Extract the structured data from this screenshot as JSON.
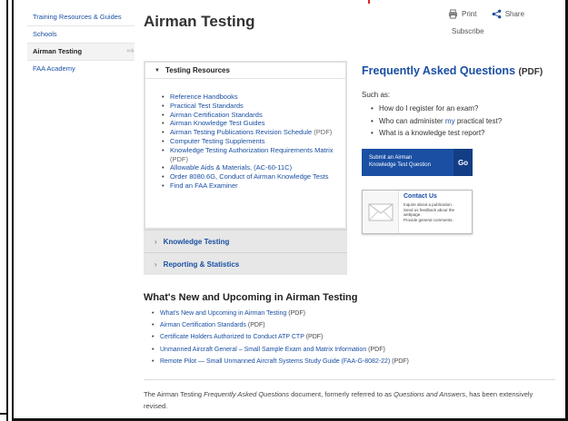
{
  "sidebar": {
    "items": [
      {
        "label": "Training Resources & Guides"
      },
      {
        "label": "Schools"
      },
      {
        "label": "Airman Testing"
      },
      {
        "label": "FAA Academy"
      }
    ]
  },
  "header": {
    "title": "Airman Testing",
    "print_label": "Print",
    "share_label": "Share",
    "subscribe_label": "Subscribe"
  },
  "accordion": {
    "open_section": {
      "label": "Testing Resources",
      "links": [
        {
          "text": "Reference Handbooks",
          "suffix": ""
        },
        {
          "text": "Practical Test Standards",
          "suffix": ""
        },
        {
          "text": "Airman Certification Standards",
          "suffix": ""
        },
        {
          "text": "Airman Knowledge Test Guides",
          "suffix": ""
        },
        {
          "text": "Airman Testing Publications Revision Schedule",
          "suffix": "(PDF)"
        },
        {
          "text": "Computer Testing Supplements",
          "suffix": ""
        },
        {
          "text": "Knowledge Testing Authorization Requirements Matrix",
          "suffix": "(PDF)"
        },
        {
          "text": "Allowable Aids & Materials,",
          "suffix": "(AC-60-11C)"
        },
        {
          "text": "Order 8080.6G, Conduct of Airman Knowledge Tests",
          "suffix": ""
        },
        {
          "text": "Find an FAA Examiner",
          "suffix": ""
        }
      ]
    },
    "closed_sections": [
      {
        "label": "Knowledge Testing"
      },
      {
        "label": "Reporting & Statistics"
      }
    ]
  },
  "faq": {
    "title": "Frequently Asked Questions",
    "title_suffix": "(PDF)",
    "intro": "Such as:",
    "questions": [
      {
        "before": "How do I register for an exam?",
        "link": "",
        "after": ""
      },
      {
        "before": "Who can administer ",
        "link": "my",
        "after": " practical test?"
      },
      {
        "before": "What is a knowledge test report?",
        "link": "",
        "after": ""
      }
    ]
  },
  "submit_box": {
    "line1": "Submit an Airman",
    "line2": "Knowledge Test Question",
    "go": "Go"
  },
  "contact_box": {
    "title": "Contact Us",
    "line1": "Inquire about a publication.",
    "line2": "Send us feedback about the",
    "line3": "webpage.",
    "line4": "Provide general comments."
  },
  "whats_new": {
    "title": "What's New and Upcoming in Airman Testing",
    "links": [
      {
        "text": "What's New and Upcoming in Airman Testing",
        "suffix": "(PDF)"
      },
      {
        "text": "Airman Certification Standards",
        "suffix": "(PDF)"
      },
      {
        "text": "Certificate Holders Authorized to Conduct ATP CTP",
        "suffix": "(PDF)"
      },
      {
        "text": "Unmanned Aircraft General – Small Sample Exam and Matrix Information",
        "suffix": "(PDF)"
      },
      {
        "text": "Remote Pilot — Small Unmanned Aircraft Systems Study Guide (FAA-G-8082-22)",
        "suffix": "(PDF)"
      }
    ]
  },
  "footnote": {
    "part1": "The Airman Testing ",
    "em1": "Frequently Asked Questions",
    "part2": " document, formerly referred to as ",
    "em2": "Questions and Answers",
    "part3": ", has been extensively revised."
  },
  "colors": {
    "link": "#1a4fa3",
    "submit_bg": "#1a4fa3",
    "accordion_closed_bg": "#e7e7e7"
  }
}
